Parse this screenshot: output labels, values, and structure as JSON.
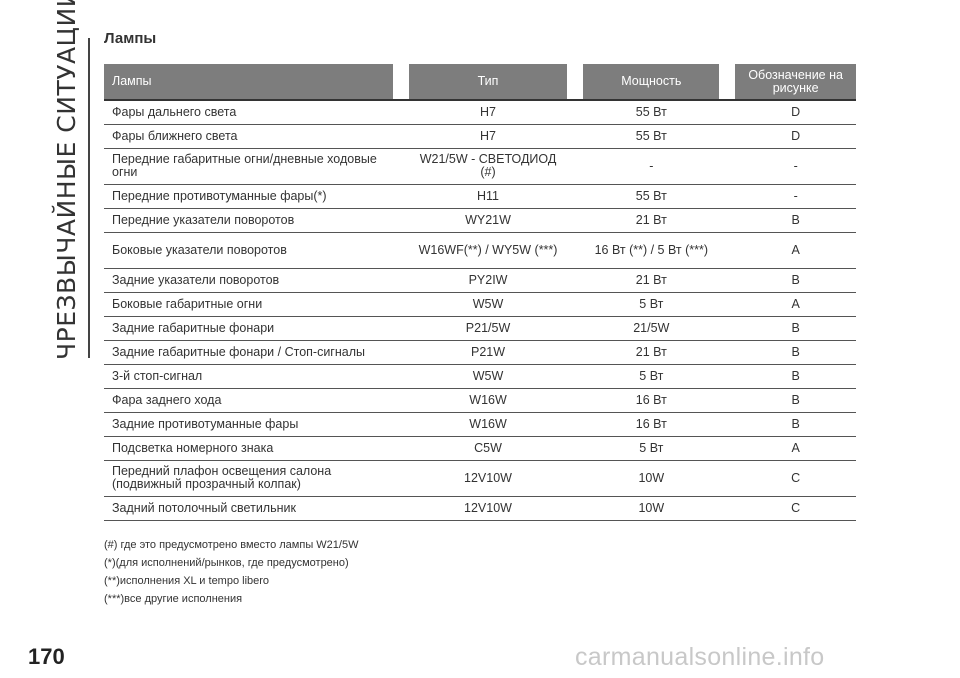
{
  "side_title": "ЧРЕЗВЫЧАЙНЫЕ СИТУАЦИИ",
  "section_title": "Лампы",
  "table": {
    "headers": [
      "Лампы",
      "Тип",
      "Мощность",
      "Обозначение на рисунке"
    ],
    "rows": [
      [
        "Фары дальнего света",
        "H7",
        "55 Вт",
        "D"
      ],
      [
        "Фары ближнего света",
        "H7",
        "55 Вт",
        "D"
      ],
      [
        "Передние габаритные огни/дневные ходовые огни",
        "W21/5W - СВЕТОДИОД (#)",
        "-",
        "-"
      ],
      [
        "Передние противотуманные фары(*)",
        "H11",
        "55 Вт",
        "-"
      ],
      [
        "Передние указатели поворотов",
        "WY21W",
        "21 Вт",
        "B"
      ],
      [
        "Боковые указатели поворотов",
        "W16WF(**) / WY5W (***)",
        "16 Вт (**) / 5 Вт (***)",
        "A"
      ],
      [
        "Задние указатели поворотов",
        "PY2IW",
        "21 Вт",
        "B"
      ],
      [
        "Боковые габаритные огни",
        "W5W",
        "5 Вт",
        "A"
      ],
      [
        "Задние габаритные фонари",
        "P21/5W",
        "21/5W",
        "B"
      ],
      [
        "Задние габаритные фонари / Стоп-сигналы",
        "P21W",
        "21 Вт",
        "B"
      ],
      [
        "3-й стоп-сигнал",
        "W5W",
        "5 Вт",
        "B"
      ],
      [
        "Фара заднего хода",
        "W16W",
        "16 Вт",
        "B"
      ],
      [
        "Задние противотуманные фары",
        "W16W",
        "16 Вт",
        "B"
      ],
      [
        "Подсветка номерного знака",
        "C5W",
        "5 Вт",
        "A"
      ],
      [
        "Передний плафон освещения салона (подвижный прозрачный колпак)",
        "12V10W",
        "10W",
        "C"
      ],
      [
        "Задний потолочный светильник",
        "12V10W",
        "10W",
        "C"
      ]
    ]
  },
  "notes": [
    "(#) где это предусмотрено вместо лампы W21/5W",
    "(*)(для исполнений/рынков, где предусмотрено)",
    "(**)исполнения XL и tempo libero",
    "(***)все другие исполнения"
  ],
  "page_number": "170",
  "watermark": "carmanualsonline.info"
}
